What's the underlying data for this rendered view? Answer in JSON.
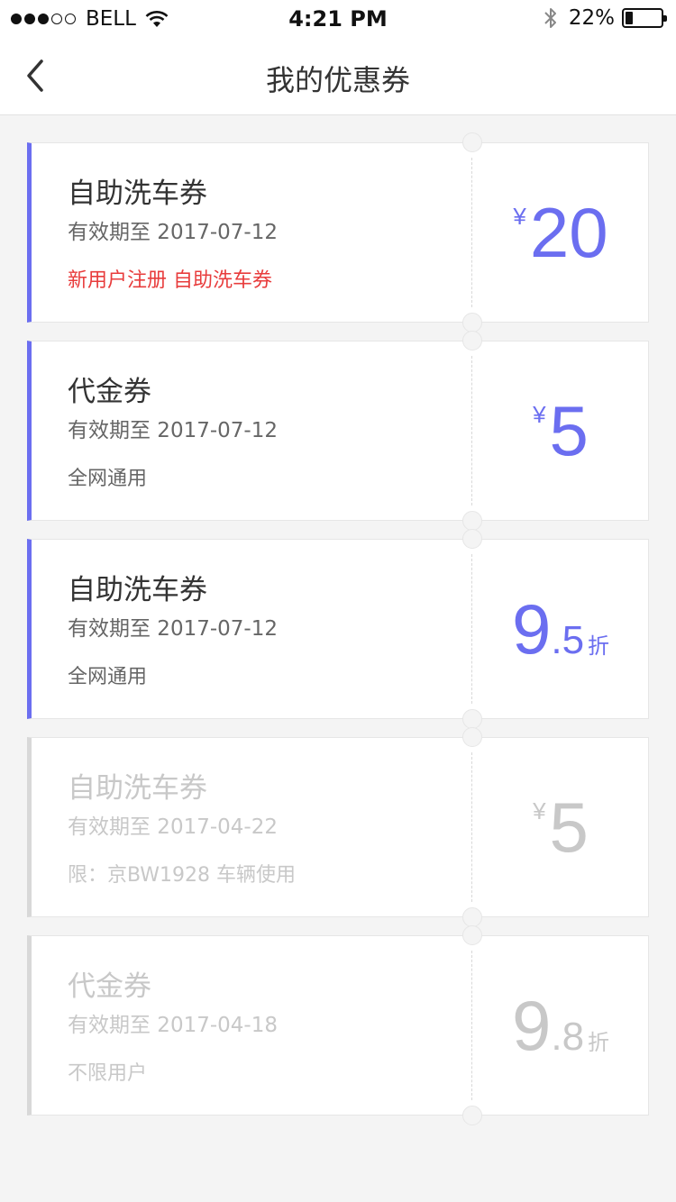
{
  "status_bar": {
    "carrier": "BELL",
    "time": "4:21 PM",
    "battery": "22%",
    "battery_level": 0.22,
    "signal_bars_filled": 3,
    "signal_bars_total": 5
  },
  "nav": {
    "title": "我的优惠券",
    "back_icon": "chevron-left-icon"
  },
  "colors": {
    "accent": "#6b6ef0",
    "red_note": "#e83c3c",
    "expired": "#c8c8c8",
    "background": "#f4f4f4"
  },
  "coupons": [
    {
      "title": "自助洗车券",
      "expiry": "有效期至 2017-07-12",
      "note": "新用户注册 自助洗车券",
      "note_red": true,
      "currency": "¥",
      "amount": "20",
      "decimal": "",
      "unit": "",
      "expired": false
    },
    {
      "title": "代金券",
      "expiry": "有效期至 2017-07-12",
      "note": "全网通用",
      "note_red": false,
      "currency": "¥",
      "amount": "5",
      "decimal": "",
      "unit": "",
      "expired": false
    },
    {
      "title": "自助洗车券",
      "expiry": "有效期至 2017-07-12",
      "note": "全网通用",
      "note_red": false,
      "currency": "",
      "amount": "9",
      "decimal": ".5",
      "unit": "折",
      "expired": false
    },
    {
      "title": "自助洗车券",
      "expiry": "有效期至 2017-04-22",
      "note": "限：京BW1928 车辆使用",
      "note_red": false,
      "currency": "¥",
      "amount": "5",
      "decimal": "",
      "unit": "",
      "expired": true
    },
    {
      "title": "代金券",
      "expiry": "有效期至 2017-04-18",
      "note": "不限用户",
      "note_red": false,
      "currency": "",
      "amount": "9",
      "decimal": ".8",
      "unit": "折",
      "expired": true
    }
  ]
}
